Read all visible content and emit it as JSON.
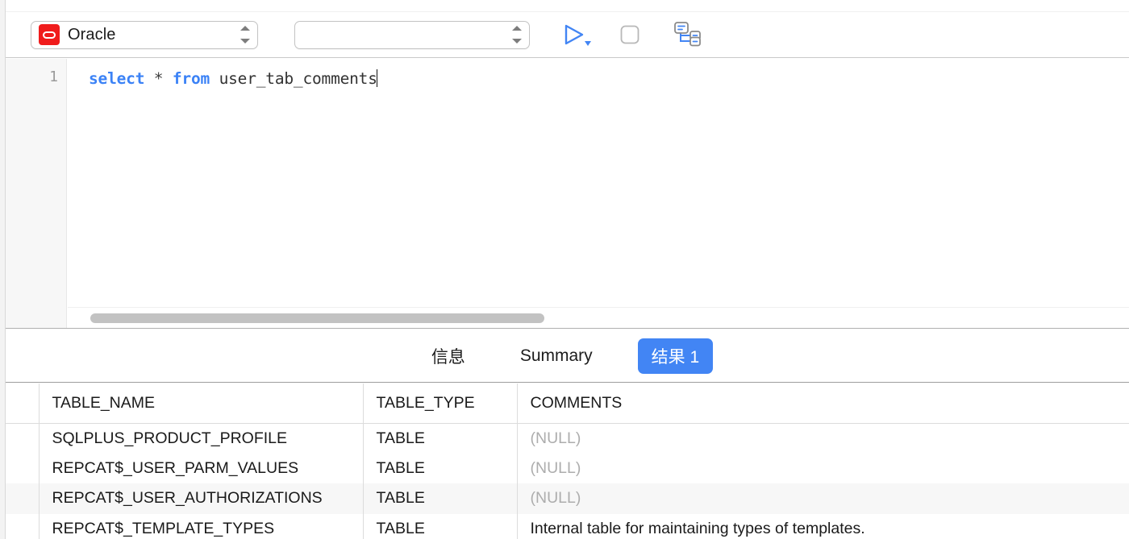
{
  "toolbar": {
    "db_selector": {
      "value": "Oracle",
      "logo_color": "#f01c1c",
      "icon": "oracle-logo-icon"
    },
    "secondary_selector": {
      "value": "",
      "placeholder": ""
    },
    "run_button": {
      "icon": "play-triangle-icon",
      "color": "#4285f4",
      "dropdown_icon": "caret-down-icon"
    },
    "stop_button": {
      "icon": "stop-square-icon",
      "color": "#b8b8b8"
    },
    "structure_button": {
      "icon": "tree-structure-icon",
      "color": "#4285f4"
    }
  },
  "editor": {
    "line_number": "1",
    "code": {
      "kw1": "select",
      "op": " * ",
      "kw2": "from",
      "ident": " user_tab_comments"
    },
    "scrollbar": {
      "orientation": "horizontal"
    }
  },
  "tabs": [
    {
      "label": "信息",
      "active": false
    },
    {
      "label": "Summary",
      "active": false
    },
    {
      "label": "结果 1",
      "active": true
    }
  ],
  "result_grid": {
    "columns": [
      "TABLE_NAME",
      "TABLE_TYPE",
      "COMMENTS"
    ],
    "null_text": "(NULL)",
    "rows": [
      {
        "table_name": "SQLPLUS_PRODUCT_PROFILE",
        "table_type": "TABLE",
        "comments": "(NULL)",
        "is_null": true,
        "alt": false
      },
      {
        "table_name": "REPCAT$_USER_PARM_VALUES",
        "table_type": "TABLE",
        "comments": "(NULL)",
        "is_null": true,
        "alt": false
      },
      {
        "table_name": "REPCAT$_USER_AUTHORIZATIONS",
        "table_type": "TABLE",
        "comments": "(NULL)",
        "is_null": true,
        "alt": true
      },
      {
        "table_name": "REPCAT$_TEMPLATE_TYPES",
        "table_type": "TABLE",
        "comments": "Internal table for maintaining types of templates.",
        "is_null": false,
        "alt": false
      }
    ]
  },
  "colors": {
    "accent_blue": "#4285f4",
    "keyword_blue": "#3b82f6",
    "oracle_red": "#f01c1c",
    "null_gray": "#adadad"
  }
}
